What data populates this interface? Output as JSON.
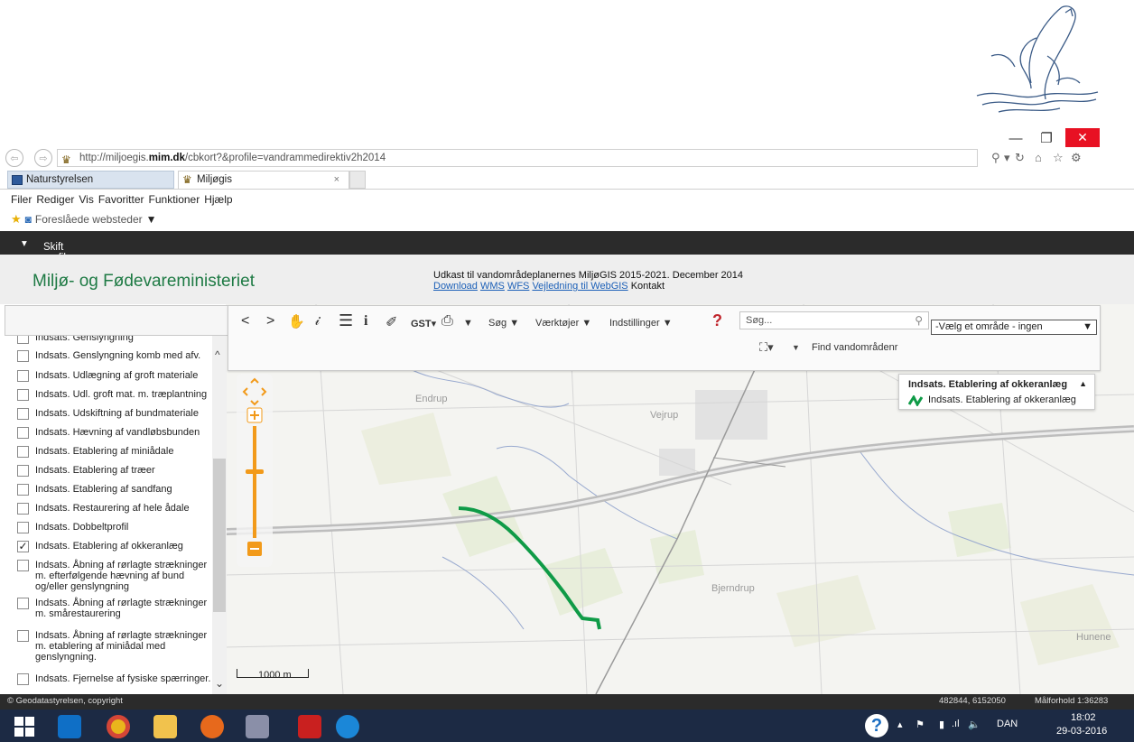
{
  "browser": {
    "url_prefix": "http://miljoegis.",
    "url_bold": "mim.dk",
    "url_suffix": "/cbkort?&profile=vandrammedirektiv2h2014",
    "tabs": [
      {
        "label": "Naturstyrelsen"
      },
      {
        "label": "Miljøgis",
        "close": "×"
      }
    ],
    "menu": [
      "Filer",
      "Rediger",
      "Vis",
      "Favoritter",
      "Funktioner",
      "Hjælp"
    ],
    "favorites_label": "Foreslåede websteder",
    "window_close": "✕"
  },
  "app": {
    "profile_label": "Skift profil",
    "ministry": "Miljø- og Fødevareministeriet",
    "header_line1": "Udkast til vandområdeplanernes MiljøGIS 2015-2021. December 2014",
    "link_download": "Download",
    "link_wms": "WMS",
    "link_wfs": "WFS",
    "link_guide": "Vejledning til WebGIS",
    "link_contact": "Kontakt"
  },
  "toolbar": {
    "gst_label": "GST",
    "search_menu": "Søg",
    "tools_menu": "Værktøjer",
    "settings_menu": "Indstillinger",
    "search_placeholder": "Søg...",
    "area_select": "-Vælg et område - ingen",
    "find_label": "Find vandområdenr"
  },
  "layers": [
    {
      "label": "Indsats. Genslyngning",
      "checked": false
    },
    {
      "label": "Indsats. Genslyngning komb med afv.",
      "checked": false
    },
    {
      "label": "Indsats. Udlægning af groft materiale",
      "checked": false
    },
    {
      "label": "Indsats. Udl. groft mat. m. træplantning",
      "checked": false
    },
    {
      "label": "Indsats. Udskiftning af bundmateriale",
      "checked": false
    },
    {
      "label": "Indsats. Hævning af vandløbsbunden",
      "checked": false
    },
    {
      "label": "Indsats. Etablering af miniådale",
      "checked": false
    },
    {
      "label": "Indsats. Etablering af træer",
      "checked": false
    },
    {
      "label": "Indsats. Etablering af sandfang",
      "checked": false
    },
    {
      "label": "Indsats. Restaurering af hele ådale",
      "checked": false
    },
    {
      "label": "Indsats. Dobbeltprofil",
      "checked": false
    },
    {
      "label": "Indsats. Etablering af okkeranlæg",
      "checked": true
    },
    {
      "label": "Indsats. Åbning af rørlagte strækninger m. efterfølgende hævning af bund og/eller genslyngning",
      "checked": false
    },
    {
      "label": "Indsats. Åbning af rørlagte strækninger m. smårestaurering",
      "checked": false
    },
    {
      "label": "Indsats. Åbning af rørlagte strækninger m. etablering af miniådal med genslyngning.",
      "checked": false
    },
    {
      "label": "Indsats. Fjernelse af fysiske spærringer.",
      "checked": false
    }
  ],
  "legend": {
    "title": "Indsats. Etablering af okkeranlæg",
    "item": "Indsats. Etablering af okkeranlæg"
  },
  "map": {
    "places": [
      "Endrup",
      "Vejrup",
      "Bjerndrup",
      "Hunene"
    ],
    "scale_label": "1000 m",
    "copyright": "© Geodatastyrelsen, copyright",
    "coords": "482844, 6152050",
    "scale_ratio": "Målforhold 1:36283",
    "highlight_color": "#0f9b47"
  },
  "taskbar": {
    "lang": "DAN",
    "time": "18:02",
    "date": "29-03-2016"
  }
}
